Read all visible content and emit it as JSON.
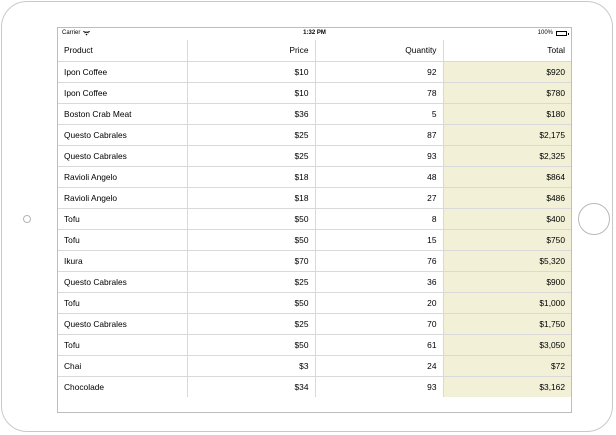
{
  "status_bar": {
    "carrier": "Carrier",
    "time": "1:32 PM",
    "battery": "100%"
  },
  "grid": {
    "columns": [
      "Product",
      "Price",
      "Quantity",
      "Total"
    ],
    "rows": [
      {
        "product": "Ipon Coffee",
        "price": "$10",
        "quantity": "92",
        "total": "$920"
      },
      {
        "product": "Ipon Coffee",
        "price": "$10",
        "quantity": "78",
        "total": "$780"
      },
      {
        "product": "Boston Crab Meat",
        "price": "$36",
        "quantity": "5",
        "total": "$180"
      },
      {
        "product": "Questo Cabrales",
        "price": "$25",
        "quantity": "87",
        "total": "$2,175"
      },
      {
        "product": "Questo Cabrales",
        "price": "$25",
        "quantity": "93",
        "total": "$2,325"
      },
      {
        "product": "Ravioli Angelo",
        "price": "$18",
        "quantity": "48",
        "total": "$864"
      },
      {
        "product": "Ravioli Angelo",
        "price": "$18",
        "quantity": "27",
        "total": "$486"
      },
      {
        "product": "Tofu",
        "price": "$50",
        "quantity": "8",
        "total": "$400"
      },
      {
        "product": "Tofu",
        "price": "$50",
        "quantity": "15",
        "total": "$750"
      },
      {
        "product": "Ikura",
        "price": "$70",
        "quantity": "76",
        "total": "$5,320"
      },
      {
        "product": "Questo Cabrales",
        "price": "$25",
        "quantity": "36",
        "total": "$900"
      },
      {
        "product": "Tofu",
        "price": "$50",
        "quantity": "20",
        "total": "$1,000"
      },
      {
        "product": "Questo Cabrales",
        "price": "$25",
        "quantity": "70",
        "total": "$1,750"
      },
      {
        "product": "Tofu",
        "price": "$50",
        "quantity": "61",
        "total": "$3,050"
      },
      {
        "product": "Chai",
        "price": "$3",
        "quantity": "24",
        "total": "$72"
      },
      {
        "product": "Chocolade",
        "price": "$34",
        "quantity": "93",
        "total": "$3,162"
      }
    ]
  },
  "colors": {
    "total_column_highlight": "#f2f1d8",
    "grid_line": "#d9d9d9"
  }
}
